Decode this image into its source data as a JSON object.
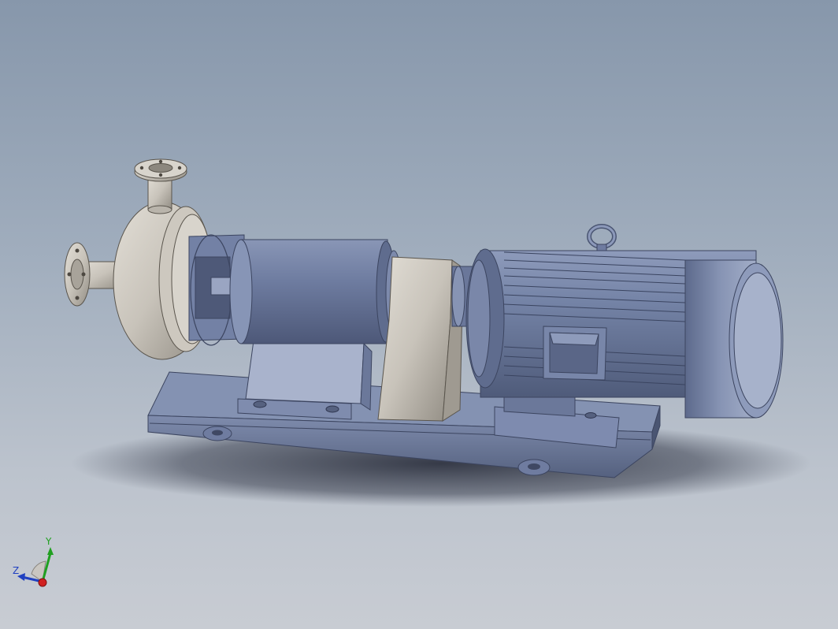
{
  "viewport": {
    "background_top": "#8797ab",
    "background_bottom": "#c8ccd3"
  },
  "model": {
    "parts": [
      {
        "name": "discharge-flange",
        "material": "stainless-steel",
        "color": "#c9c5bd"
      },
      {
        "name": "suction-flange",
        "material": "stainless-steel",
        "color": "#c9c5bd"
      },
      {
        "name": "volute-casing",
        "material": "stainless-steel",
        "color": "#c9c5bd"
      },
      {
        "name": "bearing-frame",
        "material": "painted-steel",
        "color": "#6f7ea0"
      },
      {
        "name": "support-bracket",
        "material": "stainless-steel",
        "color": "#c9c5bd"
      },
      {
        "name": "electric-motor",
        "material": "painted-steel",
        "color": "#6f7ea0"
      },
      {
        "name": "lifting-eye",
        "material": "painted-steel",
        "color": "#7b89a8"
      },
      {
        "name": "base-plate",
        "material": "painted-steel",
        "color": "#6f7ea0"
      }
    ]
  },
  "triad": {
    "x_label": "",
    "y_label": "Y",
    "z_label": "Z",
    "x_color": "#d02020",
    "y_color": "#20a020",
    "z_color": "#2040c0"
  }
}
